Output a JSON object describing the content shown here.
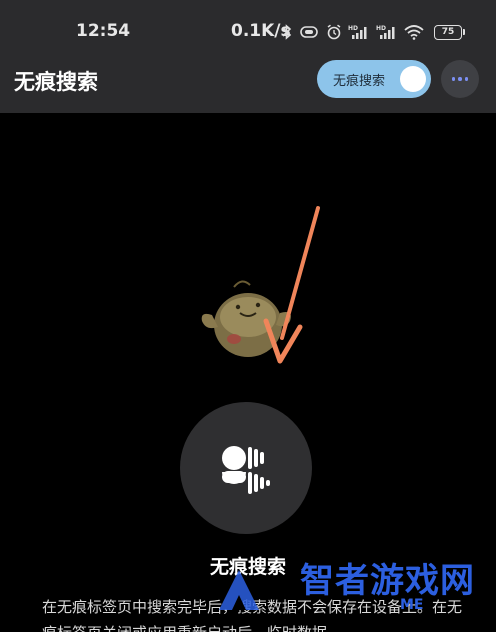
{
  "status_bar": {
    "time": "12:54",
    "network_speed": "0.1K/s",
    "battery_level": "75",
    "icons": [
      "bluetooth-icon",
      "vibrate-icon",
      "alarm-icon",
      "hd-signal-icon",
      "hd-signal-icon",
      "wifi-icon",
      "battery-icon"
    ]
  },
  "app_bar": {
    "title": "无痕搜索",
    "toggle_label": "无痕搜索",
    "toggle_on": true,
    "more_icon": "more-dots-icon"
  },
  "main": {
    "incognito_label": "无痕搜索",
    "description": "在无痕标签页中搜索完毕后，搜索数据不会保存在设备上。在无痕标签页关闭或应用重新启动后，临时数据"
  },
  "overlay": {
    "watermark_text": "智者游戏网",
    "watermark_sub": "ME"
  },
  "colors": {
    "bar_bg": "#2b2b2d",
    "toggle_bg": "#8dc4ea",
    "circle_bg": "#2f2f31",
    "arrow": "#f0855a",
    "watermark": "#2c5fe0"
  }
}
